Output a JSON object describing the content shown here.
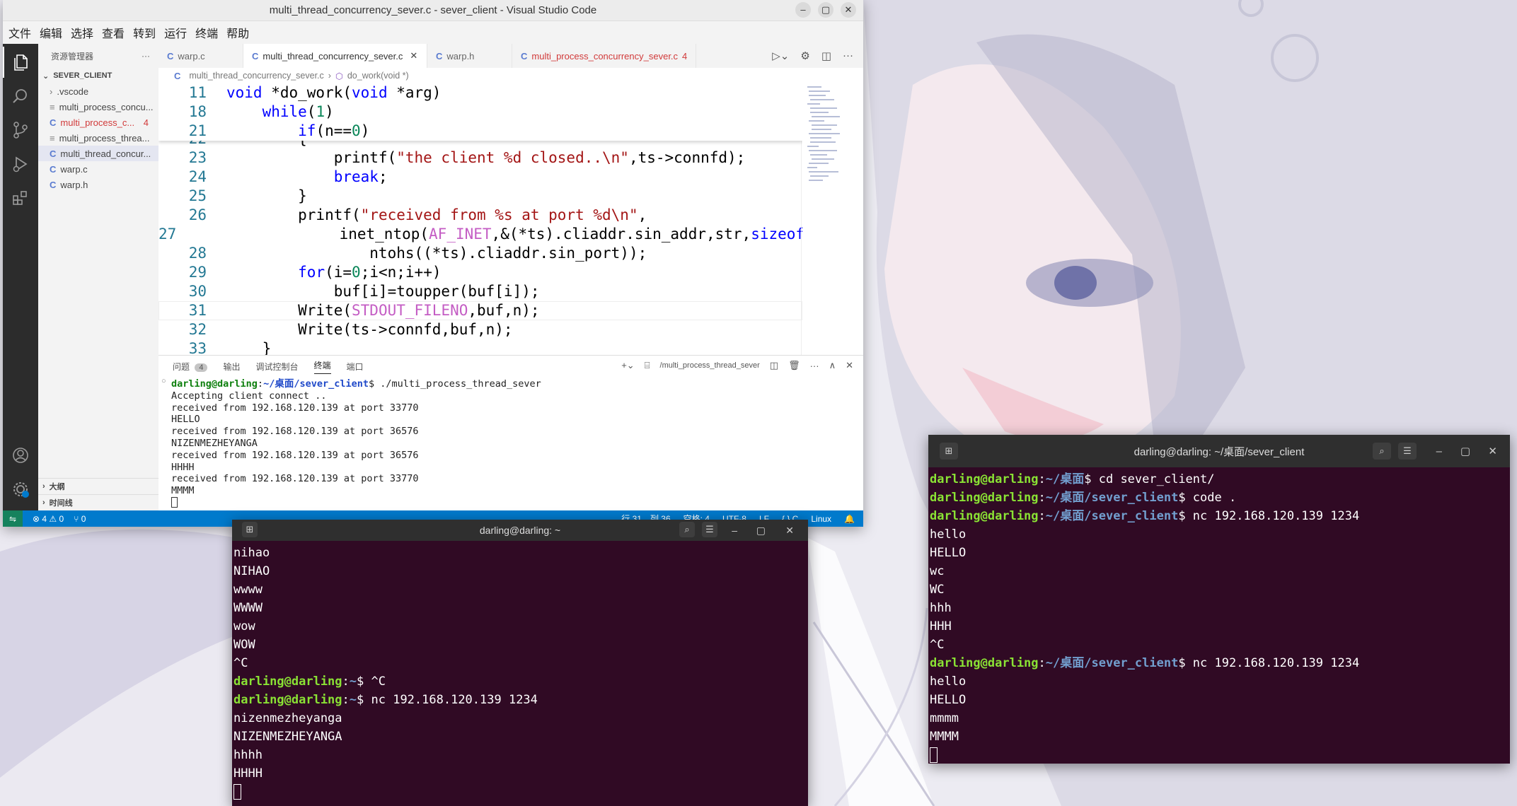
{
  "vscode": {
    "title": "multi_thread_concurrency_sever.c - sever_client - Visual Studio Code",
    "menu": [
      "文件",
      "编辑",
      "选择",
      "查看",
      "转到",
      "运行",
      "终端",
      "帮助"
    ],
    "explorer_title": "资源管理器",
    "folder": "SEVER_CLIENT",
    "files": [
      {
        "name": ".vscode",
        "kind": "folder"
      },
      {
        "name": "multi_process_concu...",
        "kind": "text"
      },
      {
        "name": "multi_process_c...",
        "kind": "c",
        "badge": "4",
        "error": true
      },
      {
        "name": "multi_process_threa...",
        "kind": "text"
      },
      {
        "name": "multi_thread_concur...",
        "kind": "c",
        "selected": true
      },
      {
        "name": "warp.c",
        "kind": "c"
      },
      {
        "name": "warp.h",
        "kind": "c"
      }
    ],
    "outline_label": "大纲",
    "timeline_label": "时间线",
    "tabs": [
      {
        "label": "warp.c"
      },
      {
        "label": "multi_thread_concurrency_sever.c",
        "active": true
      },
      {
        "label": "warp.h"
      },
      {
        "label": "multi_process_concurrency_sever.c",
        "badge": "4",
        "error": true
      }
    ],
    "breadcrumb": {
      "file": "multi_thread_concurrency_sever.c",
      "symbol": "do_work(void *)"
    },
    "sticky": [
      {
        "n": "11",
        "t": "void *do_work(void *arg)"
      },
      {
        "n": "18",
        "t": "    while(1)"
      },
      {
        "n": "21",
        "t": "        if(n==0)"
      }
    ],
    "code": [
      {
        "n": "22",
        "t": "        {"
      },
      {
        "n": "23",
        "t": "            printf(\"the client %d closed..\\n\",ts->connfd);"
      },
      {
        "n": "24",
        "t": "            break;"
      },
      {
        "n": "25",
        "t": "        }"
      },
      {
        "n": "26",
        "t": "        printf(\"received from %s at port %d\\n\","
      },
      {
        "n": "27",
        "t": "                inet_ntop(AF_INET,&(*ts).cliaddr.sin_addr,str,sizeof"
      },
      {
        "n": "28",
        "t": "                ntohs((*ts).cliaddr.sin_port));"
      },
      {
        "n": "29",
        "t": "        for(i=0;i<n;i++)"
      },
      {
        "n": "30",
        "t": "            buf[i]=toupper(buf[i]);"
      },
      {
        "n": "31",
        "t": "        Write(STDOUT_FILENO,buf,n);"
      },
      {
        "n": "32",
        "t": "        Write(ts->connfd,buf,n);"
      },
      {
        "n": "33",
        "t": "    }"
      }
    ],
    "panel_tabs": [
      {
        "label": "问题",
        "badge": "4"
      },
      {
        "label": "输出"
      },
      {
        "label": "调试控制台"
      },
      {
        "label": "终端",
        "active": true
      },
      {
        "label": "端口"
      }
    ],
    "panel_terminal_name": "/multi_process_thread_sever",
    "terminal_prompt": {
      "user": "darling@darling",
      "path": "~/桌面/sever_client",
      "cmd": "$ ./multi_process_thread_sever"
    },
    "terminal_lines": [
      "Accepting client connect ..",
      "received from 192.168.120.139 at port 33770",
      "HELLO",
      "received from 192.168.120.139 at port 36576",
      "NIZENMEZHEYANGA",
      "received from 192.168.120.139 at port 36576",
      "HHHH",
      "received from 192.168.120.139 at port 33770",
      "MMMM"
    ],
    "status": {
      "errors": "4",
      "warnings": "0",
      "ports": "0",
      "position": "行 31，列 36",
      "spaces": "空格: 4",
      "encoding": "UTF-8",
      "eol": "LF",
      "lang": "{ } C",
      "os": "Linux"
    }
  },
  "term_home": {
    "title": "darling@darling: ~",
    "lines": [
      {
        "t": "nihao"
      },
      {
        "t": "NIHAO"
      },
      {
        "t": "wwww"
      },
      {
        "t": "WWWW"
      },
      {
        "t": "wow"
      },
      {
        "t": "WOW"
      },
      {
        "t": "^C"
      },
      {
        "user": "darling@darling",
        "path": "~",
        "cmd": "$ ^C"
      },
      {
        "user": "darling@darling",
        "path": "~",
        "cmd": "$ nc 192.168.120.139 1234"
      },
      {
        "t": "nizenmezheyanga"
      },
      {
        "t": "NIZENMEZHEYANGA"
      },
      {
        "t": "hhhh"
      },
      {
        "t": "HHHH"
      }
    ]
  },
  "term_client": {
    "title": "darling@darling: ~/桌面/sever_client",
    "lines": [
      {
        "user": "darling@darling",
        "path": "~/桌面",
        "cmd": "$ cd sever_client/"
      },
      {
        "user": "darling@darling",
        "path": "~/桌面/sever_client",
        "cmd": "$ code ."
      },
      {
        "user": "darling@darling",
        "path": "~/桌面/sever_client",
        "cmd": "$ nc 192.168.120.139 1234"
      },
      {
        "t": "hello"
      },
      {
        "t": "HELLO"
      },
      {
        "t": "wc"
      },
      {
        "t": "WC"
      },
      {
        "t": "hhh"
      },
      {
        "t": "HHH"
      },
      {
        "t": "^C"
      },
      {
        "user": "darling@darling",
        "path": "~/桌面/sever_client",
        "cmd": "$ nc 192.168.120.139 1234"
      },
      {
        "t": "hello"
      },
      {
        "t": "HELLO"
      },
      {
        "t": "mmmm"
      },
      {
        "t": "MMMM"
      }
    ]
  }
}
